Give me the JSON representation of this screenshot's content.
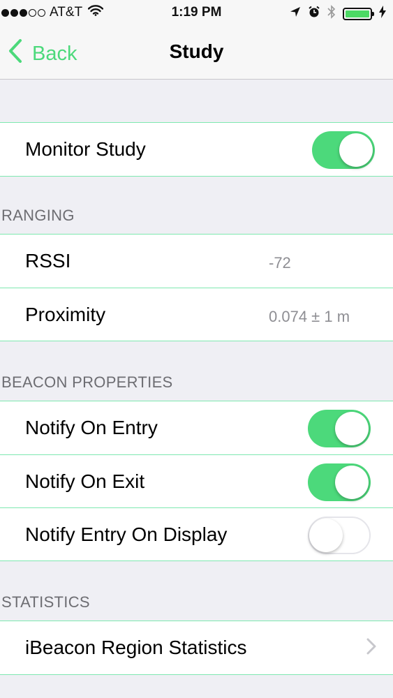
{
  "status_bar": {
    "carrier": "AT&T",
    "time": "1:19 PM",
    "signal_bars_filled": 3,
    "signal_bars_total": 5,
    "battery_level": 1.0
  },
  "nav": {
    "back_label": "Back",
    "title": "Study"
  },
  "monitor": {
    "label": "Monitor Study",
    "on": true
  },
  "ranging": {
    "header": "RANGING",
    "rssi_label": "RSSI",
    "rssi_value": "-72",
    "proximity_label": "Proximity",
    "proximity_value": "0.074 ± 1 m"
  },
  "beacon": {
    "header": "BEACON PROPERTIES",
    "notify_entry_label": "Notify On Entry",
    "notify_entry_on": true,
    "notify_exit_label": "Notify On Exit",
    "notify_exit_on": true,
    "notify_display_label": "Notify Entry On Display",
    "notify_display_on": false
  },
  "statistics": {
    "header": "STATISTICS",
    "region_label": "iBeacon Region Statistics"
  },
  "colors": {
    "accent": "#4cd97b",
    "separator": "#7ee8b0",
    "background": "#efeff4",
    "secondary_text": "#8e8e93"
  },
  "icons": [
    "wifi-icon",
    "location-arrow-icon",
    "alarm-icon",
    "bluetooth-icon",
    "battery-icon",
    "charging-bolt-icon",
    "chevron-left-icon",
    "chevron-right-icon"
  ]
}
